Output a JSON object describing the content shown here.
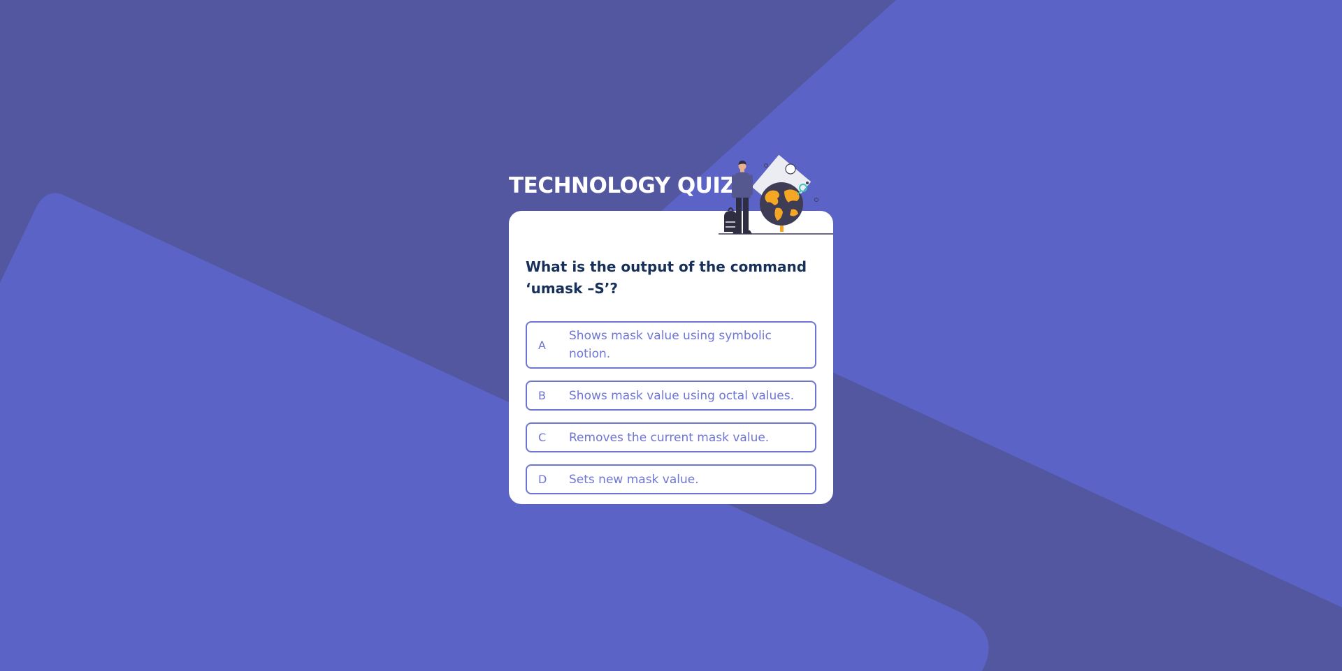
{
  "quiz": {
    "title": "TECHNOLOGY QUIZ",
    "question": "What is the output of the command ‘umask –S’?",
    "options": [
      {
        "letter": "A",
        "text": "Shows mask value using symbolic notion."
      },
      {
        "letter": "B",
        "text": "Shows mask value using octal values."
      },
      {
        "letter": "C",
        "text": "Removes the current mask value."
      },
      {
        "letter": "D",
        "text": "Sets new mask value."
      }
    ]
  },
  "icons": {
    "illustration": "person-with-globe-illustration"
  },
  "colors": {
    "background_dark": "#52579f",
    "background_light": "#5c63c6",
    "card": "#ffffff",
    "question_text": "#16305a",
    "option_accent": "#6f75d3",
    "globe_land": "#f5a623",
    "globe_body": "#3f3d56"
  }
}
